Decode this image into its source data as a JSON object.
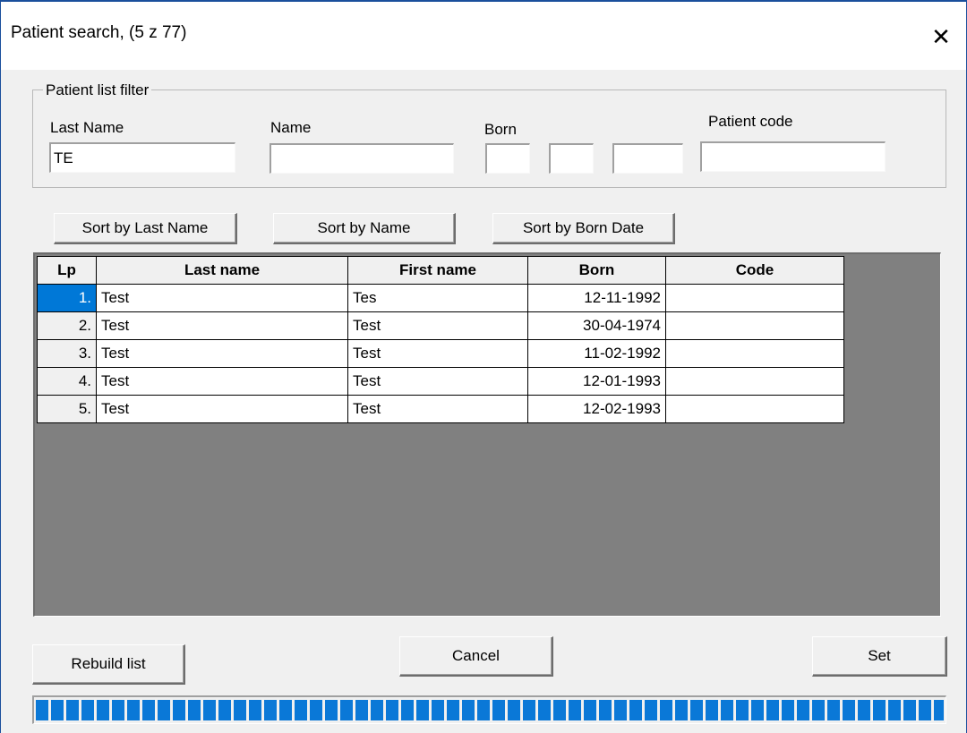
{
  "window": {
    "title": "Patient search, (5 z 77)",
    "close_icon": "close-icon"
  },
  "filter": {
    "group_label": "Patient list filter",
    "last_name_label": "Last Name",
    "name_label": "Name",
    "born_label": "Born",
    "patient_code_label": "Patient code",
    "last_name_value": "TE",
    "name_value": "",
    "born_day_value": "",
    "born_month_value": "",
    "born_year_value": "",
    "patient_code_value": ""
  },
  "sort_buttons": {
    "by_last_name": "Sort by Last Name",
    "by_name": "Sort by Name",
    "by_born_date": "Sort by Born Date"
  },
  "grid": {
    "columns": [
      "Lp",
      "Last name",
      "First name",
      "Born",
      "Code"
    ],
    "rows": [
      {
        "lp": "1.",
        "last_name": "Test",
        "first_name": "Tes",
        "born": "12-11-1992",
        "code": ""
      },
      {
        "lp": "2.",
        "last_name": "Test",
        "first_name": "Test",
        "born": "30-04-1974",
        "code": ""
      },
      {
        "lp": "3.",
        "last_name": "Test",
        "first_name": "Test",
        "born": "11-02-1992",
        "code": ""
      },
      {
        "lp": "4.",
        "last_name": "Test",
        "first_name": "Test",
        "born": "12-01-1993",
        "code": ""
      },
      {
        "lp": "5.",
        "last_name": "Test",
        "first_name": "Test",
        "born": "12-02-1993",
        "code": ""
      }
    ],
    "selected_row": 0
  },
  "actions": {
    "rebuild_label": "Rebuild list",
    "cancel_label": "Cancel",
    "set_label": "Set"
  },
  "progress": {
    "value": 1.0
  },
  "colors": {
    "selection": "#0078d7",
    "progress": "#0a78d7",
    "grid_background": "#808080"
  }
}
